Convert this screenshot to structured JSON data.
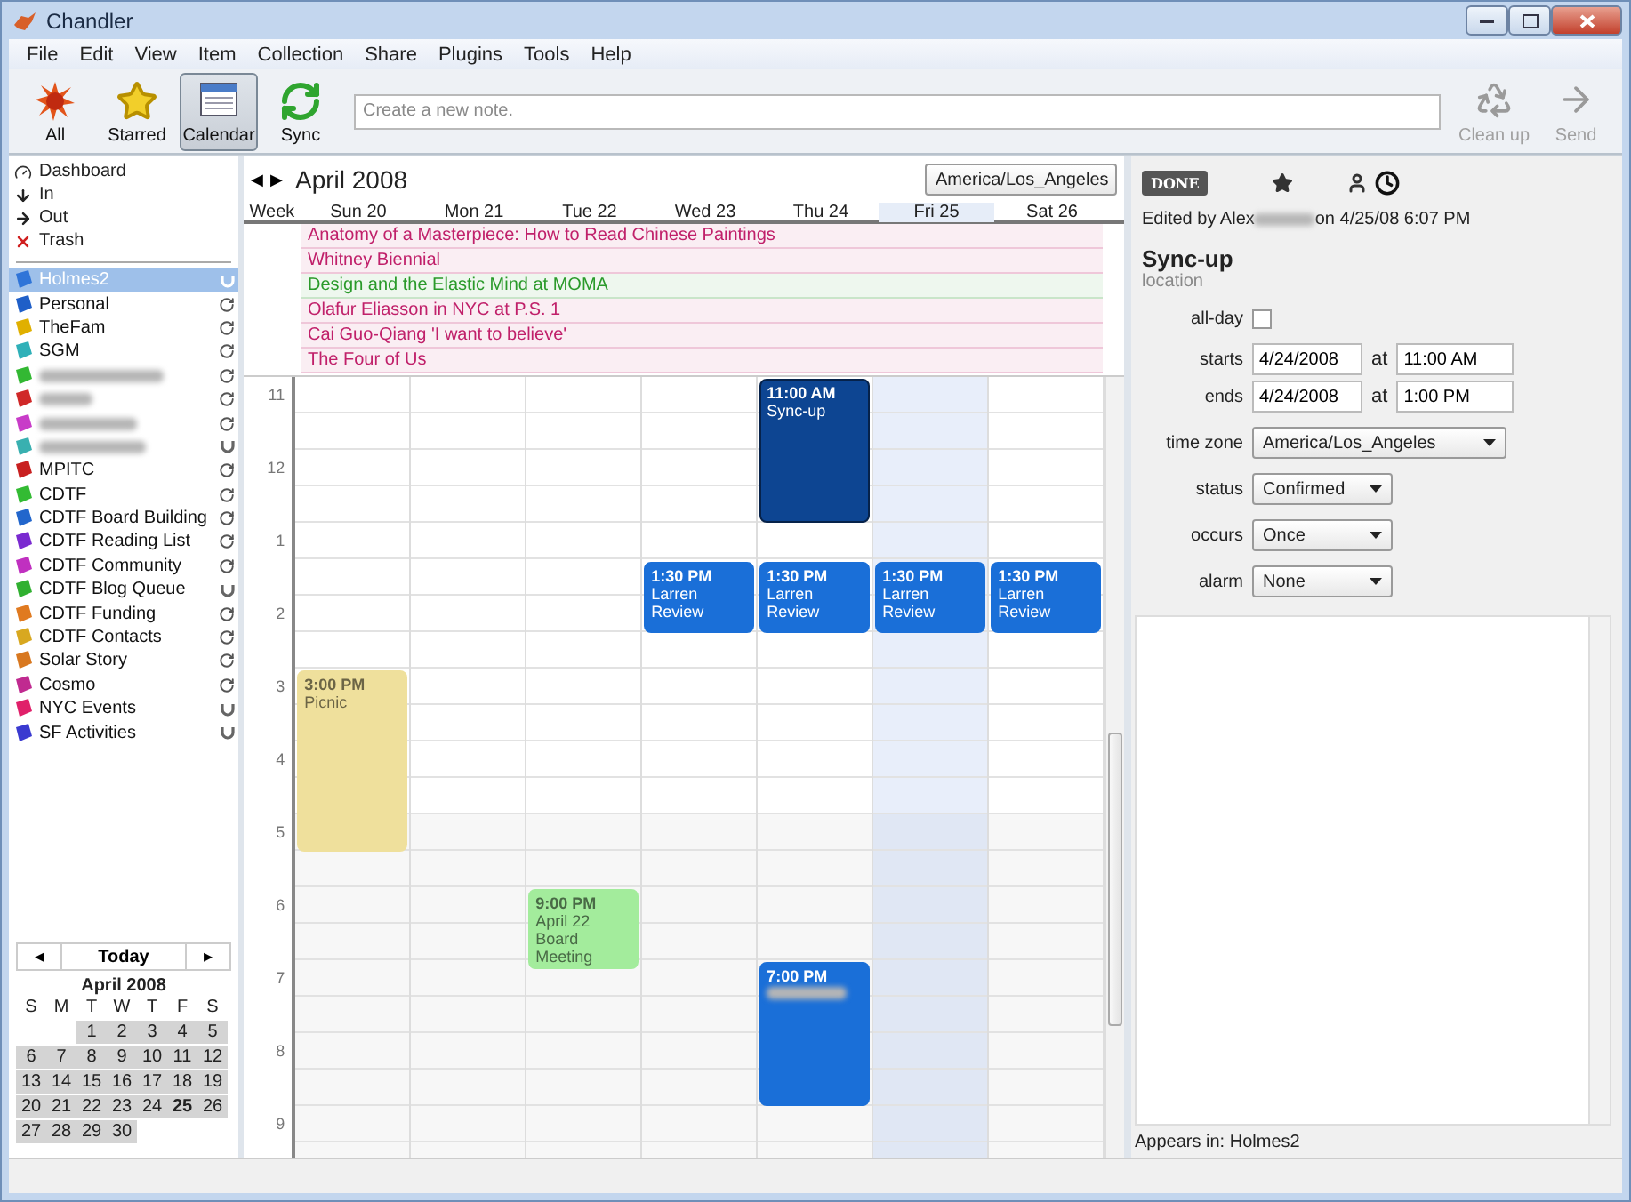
{
  "window": {
    "title": "Chandler"
  },
  "menu": [
    "File",
    "Edit",
    "View",
    "Item",
    "Collection",
    "Share",
    "Plugins",
    "Tools",
    "Help"
  ],
  "toolbar": {
    "buttons": [
      {
        "kind": "all",
        "label": "All",
        "selected": false
      },
      {
        "kind": "starred",
        "label": "Starred",
        "selected": false
      },
      {
        "kind": "calendar",
        "label": "Calendar",
        "selected": true
      },
      {
        "kind": "sync",
        "label": "Sync",
        "selected": false
      }
    ],
    "note_placeholder": "Create a new note.",
    "actions": [
      {
        "kind": "cleanup",
        "label": "Clean up",
        "disabled": true
      },
      {
        "kind": "send",
        "label": "Send",
        "disabled": true
      }
    ]
  },
  "sidebar": {
    "views": [
      {
        "kind": "dashboard",
        "label": "Dashboard"
      },
      {
        "kind": "in",
        "label": "In"
      },
      {
        "kind": "out",
        "label": "Out"
      },
      {
        "kind": "trash",
        "label": "Trash"
      }
    ],
    "collections": [
      {
        "name": "Holmes2",
        "color": "#2f74d8",
        "selected": true,
        "shared": true
      },
      {
        "name": "Personal",
        "color": "#1f5fc8",
        "selected": false,
        "shared": false
      },
      {
        "name": "TheFam",
        "color": "#e0b000",
        "selected": false,
        "shared": false
      },
      {
        "name": "SGM",
        "color": "#2fb0b8",
        "selected": false,
        "shared": false
      },
      {
        "redacted": true,
        "color": "#33b833",
        "selected": false,
        "shared": false
      },
      {
        "redacted": true,
        "color": "#d02828",
        "selected": false,
        "shared": false
      },
      {
        "redacted": true,
        "color": "#c83cc8",
        "selected": false,
        "shared": false
      },
      {
        "redacted": true,
        "color": "#39b0b0",
        "selected": false,
        "shared": true
      },
      {
        "name": "MPITC",
        "color": "#c82020",
        "selected": false,
        "shared": false
      },
      {
        "name": "CDTF",
        "color": "#33bb33",
        "selected": false,
        "shared": false
      },
      {
        "name": "CDTF Board Building",
        "color": "#2266cc",
        "selected": false,
        "shared": false
      },
      {
        "name": "CDTF Reading List",
        "color": "#7a2ad0",
        "selected": false,
        "shared": false
      },
      {
        "name": "CDTF Community",
        "color": "#c030c0",
        "selected": false,
        "shared": false
      },
      {
        "name": "CDTF Blog Queue",
        "color": "#30b030",
        "selected": false,
        "shared": true
      },
      {
        "name": "CDTF Funding",
        "color": "#e07a20",
        "selected": false,
        "shared": false
      },
      {
        "name": "CDTF Contacts",
        "color": "#d8a820",
        "selected": false,
        "shared": false
      },
      {
        "name": "Solar Story",
        "color": "#d87820",
        "selected": false,
        "shared": false
      },
      {
        "name": "Cosmo",
        "color": "#c02a90",
        "selected": false,
        "shared": false
      },
      {
        "name": "NYC Events",
        "color": "#e0206a",
        "selected": false,
        "shared": true
      },
      {
        "name": "SF Activities",
        "color": "#3a3ad0",
        "selected": false,
        "shared": true
      }
    ],
    "mini_calendar": {
      "prev": "◂",
      "today": "Today",
      "next": "▸",
      "month": "April 2008",
      "weekdays": [
        "S",
        "M",
        "T",
        "W",
        "T",
        "F",
        "S"
      ],
      "weeks": [
        [
          {
            "d": "1",
            "today": false
          },
          {
            "d": "2",
            "today": false
          },
          {
            "d": "3",
            "today": false
          },
          {
            "d": "4",
            "today": false
          },
          {
            "d": "5",
            "today": false
          }
        ],
        [
          {
            "d": "6",
            "today": false
          },
          {
            "d": "7",
            "today": false
          },
          {
            "d": "8",
            "today": false
          },
          {
            "d": "9",
            "today": false
          },
          {
            "d": "10",
            "today": false
          },
          {
            "d": "11",
            "today": false
          },
          {
            "d": "12",
            "today": false
          }
        ],
        [
          {
            "d": "13",
            "today": false
          },
          {
            "d": "14",
            "today": false
          },
          {
            "d": "15",
            "today": false
          },
          {
            "d": "16",
            "today": false
          },
          {
            "d": "17",
            "today": false
          },
          {
            "d": "18",
            "today": false
          },
          {
            "d": "19",
            "today": false
          }
        ],
        [
          {
            "d": "20",
            "today": false
          },
          {
            "d": "21",
            "today": false
          },
          {
            "d": "22",
            "today": false
          },
          {
            "d": "23",
            "today": false
          },
          {
            "d": "24",
            "today": false
          },
          {
            "d": "25",
            "today": true
          },
          {
            "d": "26",
            "today": false
          }
        ],
        [
          {
            "d": "27",
            "today": false
          },
          {
            "d": "28",
            "today": false
          },
          {
            "d": "29",
            "today": false
          },
          {
            "d": "30",
            "today": false
          }
        ]
      ]
    }
  },
  "calendar": {
    "prev": "◀",
    "next": "▶",
    "month": "April 2008",
    "timezone": "America/Los_Angeles",
    "week_label": "Week",
    "all_day": [
      {
        "title": "Anatomy of a Masterpiece: How to Read Chinese Paintings",
        "color": "#c0206a"
      },
      {
        "title": "Whitney Biennial",
        "color": "#c0206a"
      },
      {
        "title": "Design and the Elastic Mind at MOMA",
        "color": "#2a9a2a"
      },
      {
        "title": "Olafur Eliasson in NYC at P.S. 1",
        "color": "#c0206a"
      },
      {
        "title": "Cai Guo-Qiang 'I want to believe'",
        "color": "#c0206a"
      },
      {
        "title": "The Four of Us",
        "color": "#c0206a"
      }
    ],
    "hours": [
      "11",
      "12",
      "1",
      "2",
      "3",
      "4",
      "5",
      "6",
      "7",
      "8",
      "9"
    ],
    "days": [
      {
        "label": "Sun 20",
        "today": false,
        "events": [
          {
            "time": "3:00 PM",
            "title": "Picnic",
            "color": "#efe09c",
            "selected": false
          }
        ]
      },
      {
        "label": "Mon 21",
        "today": false
      },
      {
        "label": "Tue 22",
        "today": false,
        "events": [
          {
            "time": "9:00 PM",
            "title": "April 22 Board Meeting",
            "color": "#a3ec9c",
            "selected": false
          }
        ]
      },
      {
        "label": "Wed 23",
        "today": false,
        "events": [
          {
            "time": "1:30 PM",
            "title": "Larren Review",
            "color": "#1a6fd8",
            "selected": false
          }
        ]
      },
      {
        "label": "Thu 24",
        "today": false,
        "events": [
          {
            "time": "11:00 AM",
            "title": "Sync-up",
            "color": "#0d4592",
            "selected": true
          },
          {
            "time": "1:30 PM",
            "title": "Larren Review",
            "color": "#1a6fd8",
            "selected": false
          },
          {
            "time": "7:00 PM",
            "redacted": true,
            "color": "#1a6fd8",
            "selected": false
          }
        ]
      },
      {
        "label": "Fri 25",
        "today": true,
        "events": [
          {
            "time": "1:30 PM",
            "title": "Larren Review",
            "color": "#1a6fd8",
            "selected": false
          }
        ]
      },
      {
        "label": "Sat 26",
        "today": false,
        "events": [
          {
            "time": "1:30 PM",
            "title": "Larren Review",
            "color": "#1a6fd8",
            "selected": false
          }
        ]
      }
    ]
  },
  "detail": {
    "done": "DONE",
    "edited_by": "Edited by Alex",
    "edited_redacted": true,
    "edited_time": "on 4/25/08 6:07 PM",
    "title": "Sync-up",
    "location_placeholder": "location",
    "all_day": {
      "label": "all-day",
      "checked": false
    },
    "times": [
      {
        "label": "starts",
        "date": "4/24/2008",
        "at": "at",
        "time": "11:00 AM"
      },
      {
        "label": "ends",
        "date": "4/24/2008",
        "at": "at",
        "time": "1:00 PM"
      }
    ],
    "selects": [
      {
        "label": "time zone",
        "value": "America/Los_Angeles"
      },
      {
        "label": "status",
        "value": "Confirmed"
      },
      {
        "label": "occurs",
        "value": "Once"
      },
      {
        "label": "alarm",
        "value": "None"
      }
    ],
    "appears_in": "Appears in: Holmes2"
  }
}
